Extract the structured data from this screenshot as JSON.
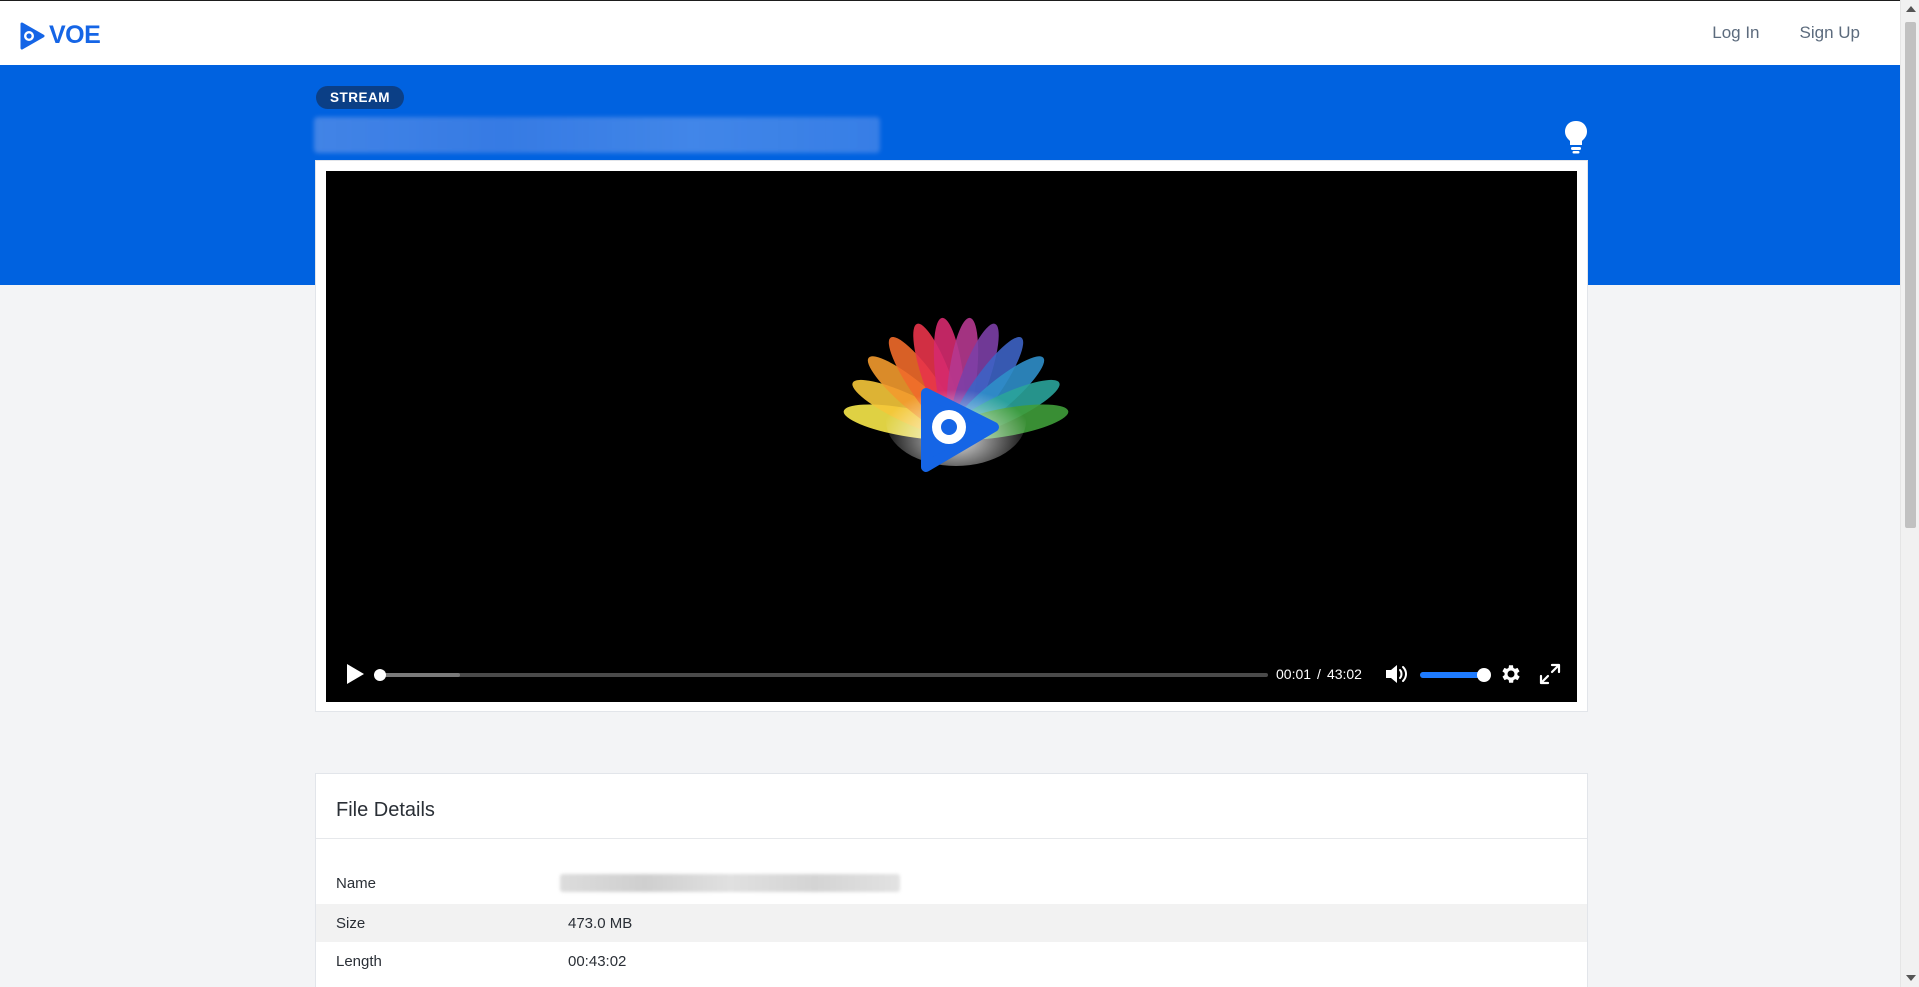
{
  "brand": {
    "name": "VOE",
    "color": "#1565e6"
  },
  "nav": {
    "login": "Log In",
    "signup": "Sign Up"
  },
  "hero": {
    "badge": "STREAM",
    "color": "#0062e0"
  },
  "player": {
    "current_time": "00:01",
    "separator": "/",
    "duration": "43:02",
    "progress_fraction": 0.0004,
    "buffered_fraction": 0.09,
    "volume_fraction": 1.0,
    "accent": "#1e7bff",
    "icons": [
      "play-icon",
      "volume-icon",
      "gear-icon",
      "fullscreen-icon",
      "lightbulb-icon"
    ]
  },
  "details": {
    "heading": "File Details",
    "rows": [
      {
        "label": "Name",
        "value": ""
      },
      {
        "label": "Size",
        "value": "473.0 MB"
      },
      {
        "label": "Length",
        "value": "00:43:02"
      }
    ]
  }
}
